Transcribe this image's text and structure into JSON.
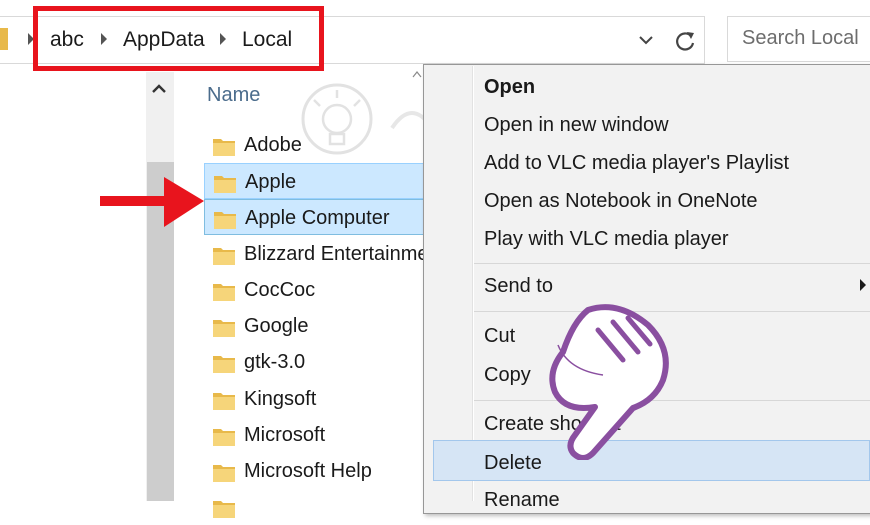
{
  "breadcrumb": {
    "items": [
      "abc",
      "AppData",
      "Local"
    ]
  },
  "search": {
    "placeholder": "Search Local"
  },
  "file_list": {
    "column_name": "Name",
    "rows": [
      {
        "name": "Adobe",
        "selected": false
      },
      {
        "name": "Apple",
        "selected": true
      },
      {
        "name": "Apple Computer",
        "selected": true
      },
      {
        "name": "Blizzard Entertainment",
        "selected": false
      },
      {
        "name": "CocCoc",
        "selected": false
      },
      {
        "name": "Google",
        "selected": false
      },
      {
        "name": "gtk-3.0",
        "selected": false
      },
      {
        "name": "Kingsoft",
        "selected": false
      },
      {
        "name": "Microsoft",
        "selected": false
      },
      {
        "name": "Microsoft Help",
        "selected": false
      }
    ]
  },
  "context_menu": {
    "open": "Open",
    "open_new_window": "Open in new window",
    "add_vlc_playlist": "Add to VLC media player's Playlist",
    "open_onenote": "Open as Notebook in OneNote",
    "play_vlc": "Play with VLC media player",
    "send_to": "Send to",
    "cut": "Cut",
    "copy": "Copy",
    "create_shortcut": "Create shortcut",
    "delete": "Delete",
    "rename": "Rename"
  },
  "colors": {
    "highlight_red": "#e8141d",
    "selection": "#cce8ff",
    "menu_hover": "#d6e5f5",
    "hand_purple": "#8a4fa0"
  }
}
